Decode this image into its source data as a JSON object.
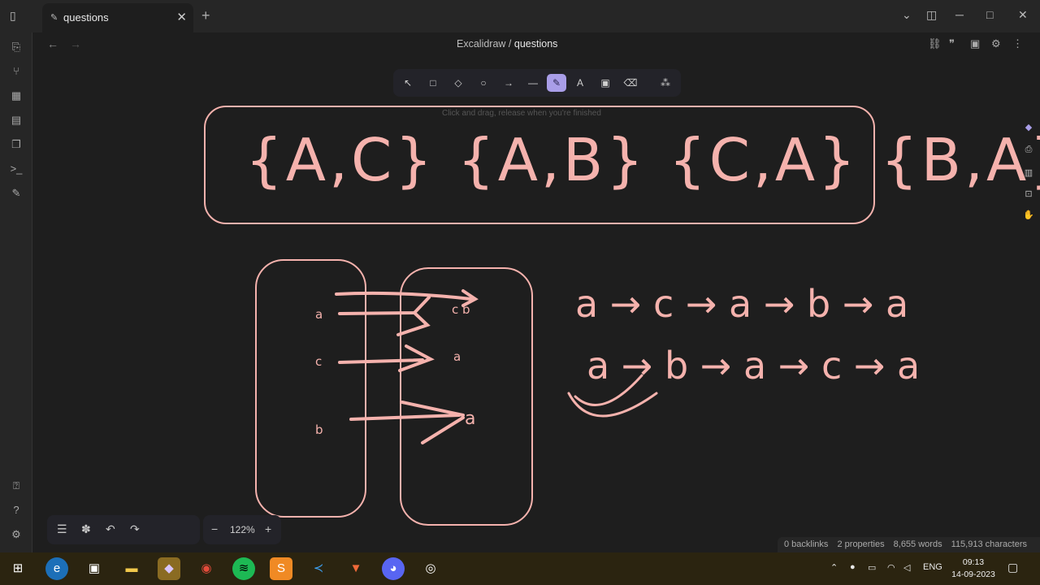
{
  "window": {
    "tab_title": "questions",
    "new_tab": "+",
    "close": "✕"
  },
  "breadcrumb": {
    "parent": "Excalidraw",
    "separator": "/",
    "current": "questions"
  },
  "toolbar": {
    "hint": "Click and drag, release when you're finished",
    "active_tool": "pen"
  },
  "drawing": {
    "set_list": "{A,C} {A,B} {C,A} {B,A}",
    "left_box_labels": [
      "a",
      "c",
      "b"
    ],
    "right_box_labels": [
      "c b",
      "a",
      "a"
    ],
    "chain_1": "a → c → a → b → a",
    "chain_2": "a → b → a → c → a",
    "stroke_color": "#f5b2ad"
  },
  "zoom": {
    "value": "122%",
    "minus": "−",
    "plus": "+"
  },
  "status": {
    "backlinks": "0 backlinks",
    "properties": "2 properties",
    "words": "8,655 words",
    "characters": "115,913 characters"
  },
  "system": {
    "language": "ENG",
    "time": "09:13",
    "date": "14-09-2023"
  }
}
